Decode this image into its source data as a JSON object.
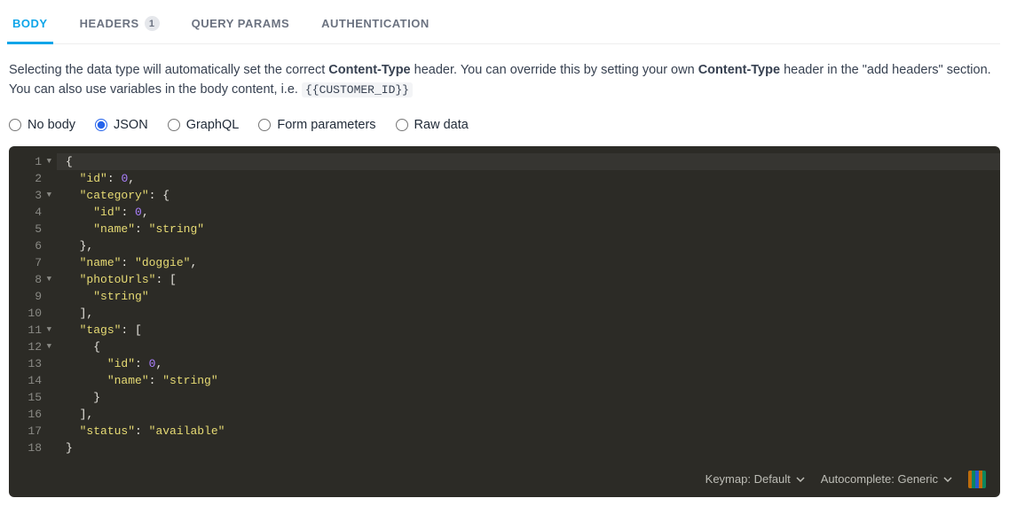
{
  "tabs": {
    "body": {
      "label": "BODY",
      "active": true
    },
    "headers": {
      "label": "HEADERS",
      "badge": "1",
      "active": false
    },
    "query_params": {
      "label": "QUERY PARAMS",
      "active": false
    },
    "authentication": {
      "label": "AUTHENTICATION",
      "active": false
    }
  },
  "description": {
    "part1": "Selecting the data type will automatically set the correct ",
    "bold1": "Content-Type",
    "part2": " header. You can override this by setting your own ",
    "bold2": "Content-Type",
    "part3": " header in the \"add headers\" section. You can also use variables in the body content, i.e. ",
    "code": "{{CUSTOMER_ID}}"
  },
  "body_type": {
    "selected": "json",
    "options": {
      "no_body": "No body",
      "json": "JSON",
      "graphql": "GraphQL",
      "form": "Form parameters",
      "raw": "Raw data"
    }
  },
  "editor": {
    "lines": [
      {
        "n": "1",
        "fold": true,
        "hl": true,
        "tokens": [
          {
            "t": "punct",
            "v": "{"
          }
        ]
      },
      {
        "n": "2",
        "fold": false,
        "tokens": [
          {
            "t": "ws",
            "v": "  "
          },
          {
            "t": "key",
            "v": "\"id\""
          },
          {
            "t": "punct",
            "v": ": "
          },
          {
            "t": "num",
            "v": "0"
          },
          {
            "t": "punct",
            "v": ","
          }
        ]
      },
      {
        "n": "3",
        "fold": true,
        "tokens": [
          {
            "t": "ws",
            "v": "  "
          },
          {
            "t": "key",
            "v": "\"category\""
          },
          {
            "t": "punct",
            "v": ": {"
          }
        ]
      },
      {
        "n": "4",
        "fold": false,
        "tokens": [
          {
            "t": "ws",
            "v": "    "
          },
          {
            "t": "key",
            "v": "\"id\""
          },
          {
            "t": "punct",
            "v": ": "
          },
          {
            "t": "num",
            "v": "0"
          },
          {
            "t": "punct",
            "v": ","
          }
        ]
      },
      {
        "n": "5",
        "fold": false,
        "tokens": [
          {
            "t": "ws",
            "v": "    "
          },
          {
            "t": "key",
            "v": "\"name\""
          },
          {
            "t": "punct",
            "v": ": "
          },
          {
            "t": "str",
            "v": "\"string\""
          }
        ]
      },
      {
        "n": "6",
        "fold": false,
        "tokens": [
          {
            "t": "ws",
            "v": "  "
          },
          {
            "t": "punct",
            "v": "},"
          }
        ]
      },
      {
        "n": "7",
        "fold": false,
        "tokens": [
          {
            "t": "ws",
            "v": "  "
          },
          {
            "t": "key",
            "v": "\"name\""
          },
          {
            "t": "punct",
            "v": ": "
          },
          {
            "t": "str",
            "v": "\"doggie\""
          },
          {
            "t": "punct",
            "v": ","
          }
        ]
      },
      {
        "n": "8",
        "fold": true,
        "tokens": [
          {
            "t": "ws",
            "v": "  "
          },
          {
            "t": "key",
            "v": "\"photoUrls\""
          },
          {
            "t": "punct",
            "v": ": ["
          }
        ]
      },
      {
        "n": "9",
        "fold": false,
        "tokens": [
          {
            "t": "ws",
            "v": "    "
          },
          {
            "t": "str",
            "v": "\"string\""
          }
        ]
      },
      {
        "n": "10",
        "fold": false,
        "tokens": [
          {
            "t": "ws",
            "v": "  "
          },
          {
            "t": "punct",
            "v": "],"
          }
        ]
      },
      {
        "n": "11",
        "fold": true,
        "tokens": [
          {
            "t": "ws",
            "v": "  "
          },
          {
            "t": "key",
            "v": "\"tags\""
          },
          {
            "t": "punct",
            "v": ": ["
          }
        ]
      },
      {
        "n": "12",
        "fold": true,
        "tokens": [
          {
            "t": "ws",
            "v": "    "
          },
          {
            "t": "punct",
            "v": "{"
          }
        ]
      },
      {
        "n": "13",
        "fold": false,
        "tokens": [
          {
            "t": "ws",
            "v": "      "
          },
          {
            "t": "key",
            "v": "\"id\""
          },
          {
            "t": "punct",
            "v": ": "
          },
          {
            "t": "num",
            "v": "0"
          },
          {
            "t": "punct",
            "v": ","
          }
        ]
      },
      {
        "n": "14",
        "fold": false,
        "tokens": [
          {
            "t": "ws",
            "v": "      "
          },
          {
            "t": "key",
            "v": "\"name\""
          },
          {
            "t": "punct",
            "v": ": "
          },
          {
            "t": "str",
            "v": "\"string\""
          }
        ]
      },
      {
        "n": "15",
        "fold": false,
        "tokens": [
          {
            "t": "ws",
            "v": "    "
          },
          {
            "t": "punct",
            "v": "}"
          }
        ]
      },
      {
        "n": "16",
        "fold": false,
        "tokens": [
          {
            "t": "ws",
            "v": "  "
          },
          {
            "t": "punct",
            "v": "],"
          }
        ]
      },
      {
        "n": "17",
        "fold": false,
        "tokens": [
          {
            "t": "ws",
            "v": "  "
          },
          {
            "t": "key",
            "v": "\"status\""
          },
          {
            "t": "punct",
            "v": ": "
          },
          {
            "t": "str",
            "v": "\"available\""
          }
        ]
      },
      {
        "n": "18",
        "fold": false,
        "tokens": [
          {
            "t": "punct",
            "v": "}"
          }
        ]
      }
    ],
    "footer": {
      "keymap_label": "Keymap: Default",
      "autocomplete_label": "Autocomplete: Generic"
    }
  }
}
